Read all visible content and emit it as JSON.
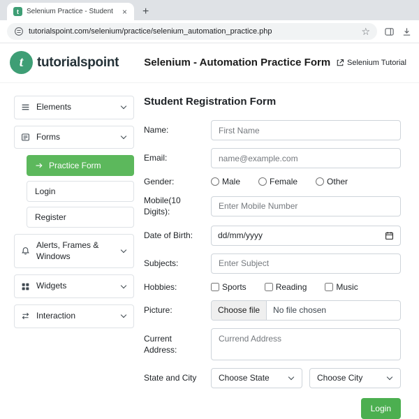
{
  "browser": {
    "tab_title": "Selenium Practice - Student",
    "url": "tutorialspoint.com/selenium/practice/selenium_automation_practice.php",
    "icons": {
      "close": "×",
      "new_tab": "+",
      "star": "☆"
    }
  },
  "header": {
    "logo_letter": "t",
    "brand": "tutorialspoint",
    "title": "Selenium - Automation Practice Form",
    "link_label": "Selenium Tutorial"
  },
  "sidebar": {
    "items": [
      {
        "label": "Elements"
      },
      {
        "label": "Forms"
      },
      {
        "label": "Alerts, Frames & Windows"
      },
      {
        "label": "Widgets"
      },
      {
        "label": "Interaction"
      }
    ],
    "forms_children": [
      {
        "label": "Practice Form"
      },
      {
        "label": "Login"
      },
      {
        "label": "Register"
      }
    ]
  },
  "form": {
    "title": "Student Registration Form",
    "fields": {
      "name": {
        "label": "Name:",
        "placeholder": "First Name"
      },
      "email": {
        "label": "Email:",
        "placeholder": "name@example.com"
      },
      "gender": {
        "label": "Gender:",
        "options": [
          "Male",
          "Female",
          "Other"
        ]
      },
      "mobile": {
        "label": "Mobile(10 Digits):",
        "placeholder": "Enter Mobile Number"
      },
      "dob": {
        "label": "Date of Birth:",
        "value": "dd/mm/yyyy"
      },
      "subjects": {
        "label": "Subjects:",
        "placeholder": "Enter Subject"
      },
      "hobbies": {
        "label": "Hobbies:",
        "options": [
          "Sports",
          "Reading",
          "Music"
        ]
      },
      "picture": {
        "label": "Picture:",
        "button": "Choose file",
        "status": "No file chosen"
      },
      "address": {
        "label": "Current Address:",
        "placeholder": "Currend Address"
      },
      "state_city": {
        "label": "State and City",
        "state_placeholder": "Choose State",
        "city_placeholder": "Choose City"
      }
    },
    "submit_label": "Login"
  },
  "colors": {
    "brand_green": "#3e9e75",
    "active_item_green": "#5cb85c",
    "button_green": "#4caf50"
  }
}
